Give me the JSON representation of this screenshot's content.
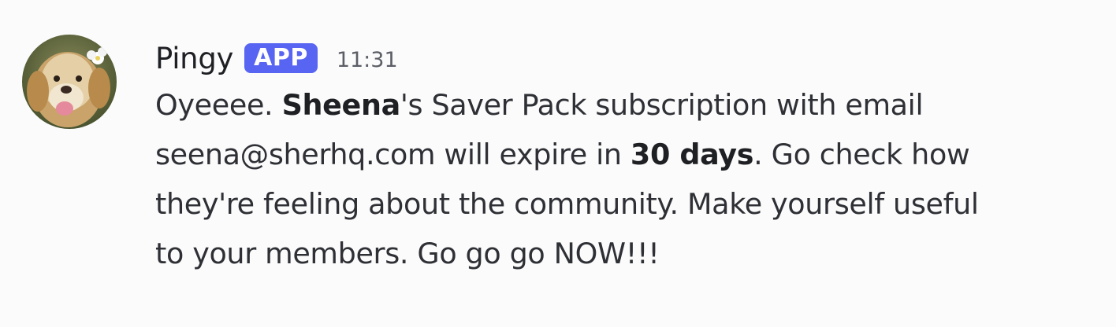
{
  "message": {
    "author": "Pingy",
    "badge": "APP",
    "timestamp": "11:31",
    "avatar_icon": "dog-avatar-icon",
    "lines": [
      {
        "pre": "Oyeeee. ",
        "bold": "Sheena",
        "post": "'s Saver Pack subscription with email"
      },
      {
        "pre": "seena@sherhq.com will expire in ",
        "bold": "30 days",
        "post": ". Go check how"
      },
      {
        "pre": "they're feeling about the community. Make yourself useful"
      },
      {
        "pre": "to your members. Go go go NOW!!!"
      }
    ]
  },
  "colors": {
    "background": "#fbfbfb",
    "badge": "#5865f2",
    "text": "#2e3035",
    "timestamp": "#5c5e66"
  }
}
